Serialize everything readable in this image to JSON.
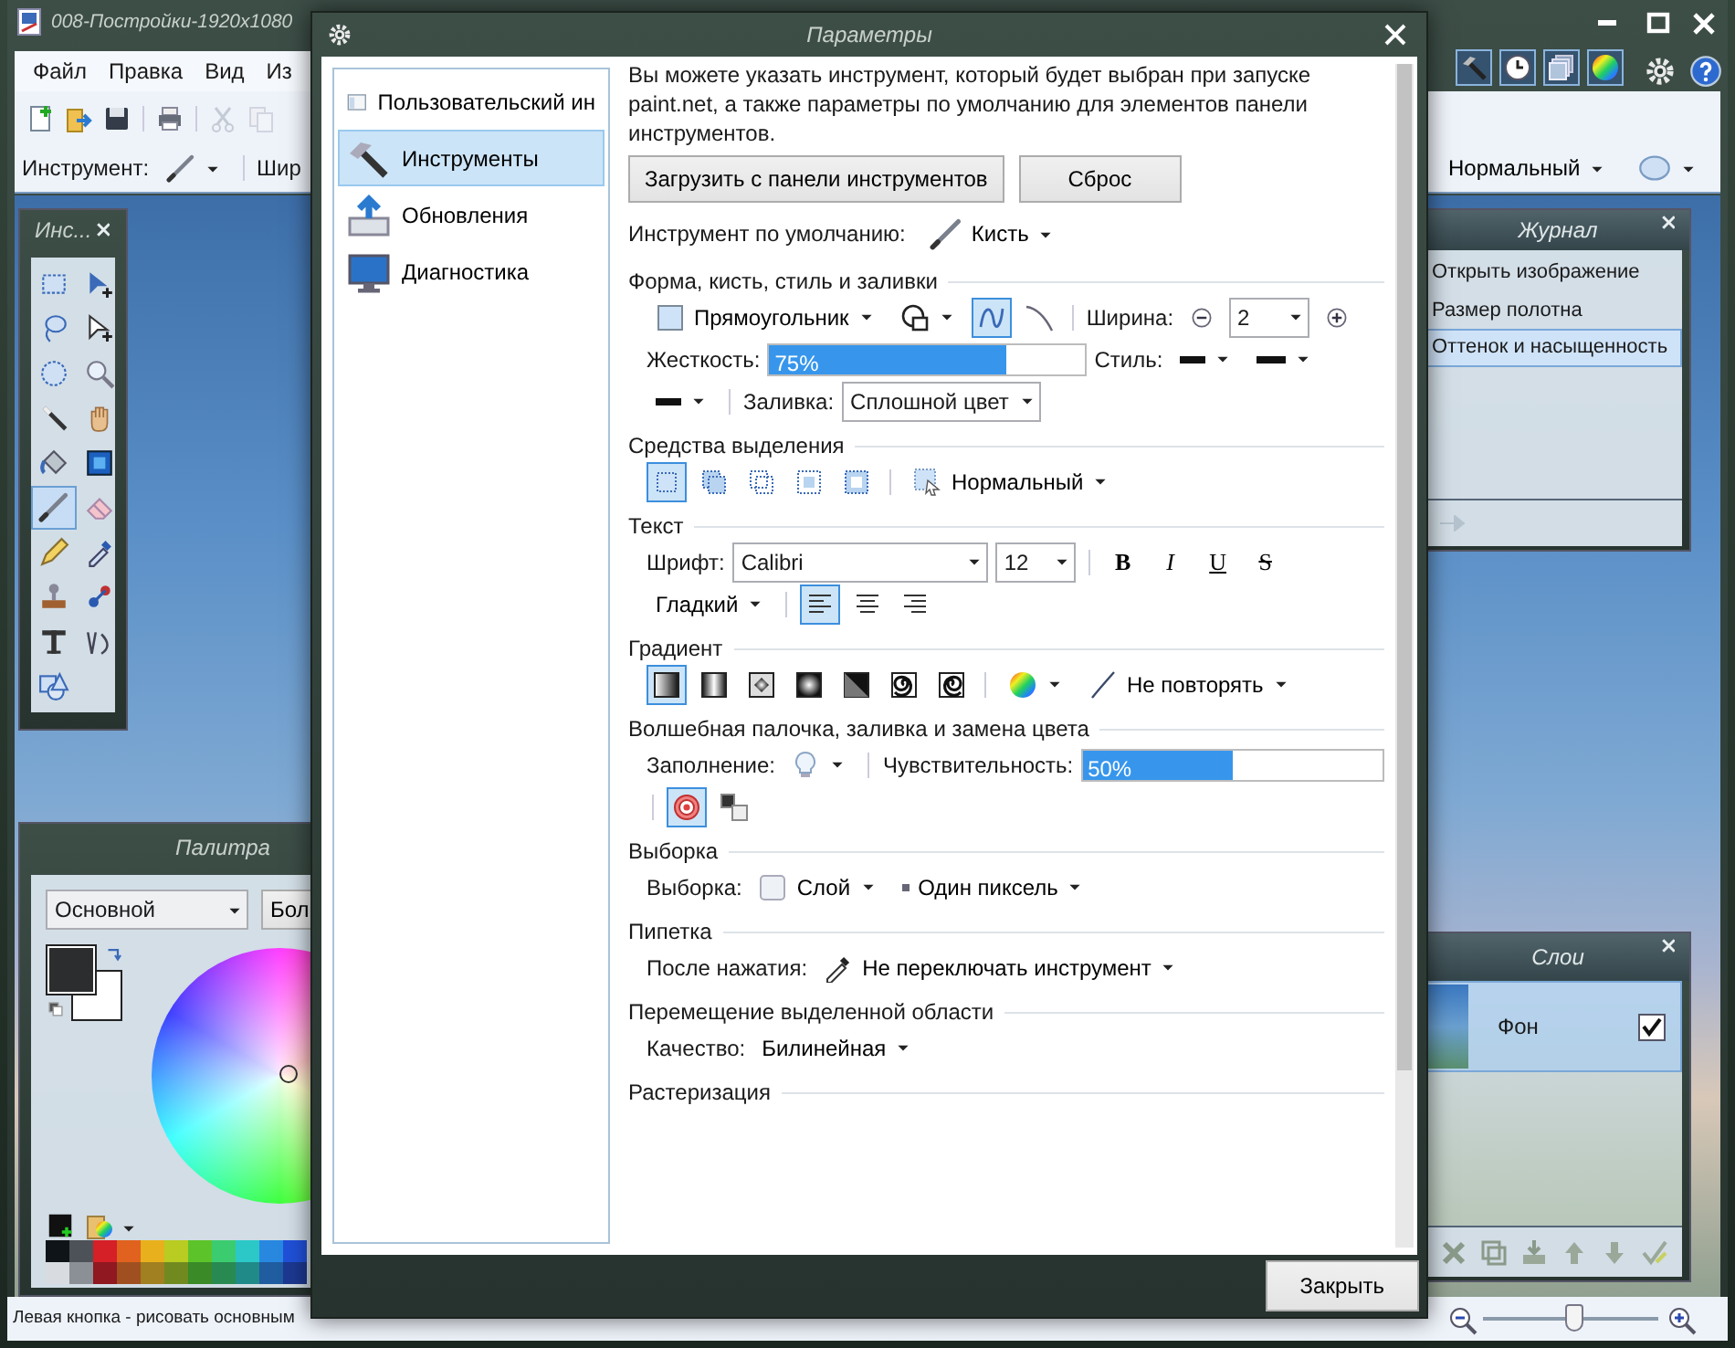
{
  "app": {
    "title": "008-Постройки-1920x1080",
    "menu": [
      "Файл",
      "Правка",
      "Вид",
      "Из"
    ],
    "toolbar": [
      {
        "kind": "new",
        "disabled": false
      },
      {
        "kind": "open",
        "disabled": false
      },
      {
        "kind": "save",
        "disabled": false
      },
      {
        "kind": "print",
        "disabled": false
      },
      {
        "kind": "cut",
        "disabled": true
      },
      {
        "kind": "copy",
        "disabled": true
      }
    ],
    "tool_label": "Инструмент:",
    "width_label": "Шир",
    "blend_mode": "Нормальный",
    "window_toggles": [
      {
        "kind": "tools",
        "on": true
      },
      {
        "kind": "history",
        "on": true
      },
      {
        "kind": "layers",
        "on": true
      },
      {
        "kind": "colors",
        "on": true
      }
    ],
    "status": "Левая кнопка - рисовать основным",
    "zoom": {
      "level": 0.52
    }
  },
  "tools_panel": {
    "title": "Инс...",
    "tools": [
      {
        "kind": "rect-select",
        "selected": false
      },
      {
        "kind": "move-pixels",
        "selected": false
      },
      {
        "kind": "lasso",
        "selected": false
      },
      {
        "kind": "move-selection",
        "selected": false
      },
      {
        "kind": "ellipse-select",
        "selected": false
      },
      {
        "kind": "zoom",
        "selected": false
      },
      {
        "kind": "magic-wand",
        "selected": false
      },
      {
        "kind": "pan",
        "selected": false
      },
      {
        "kind": "bucket",
        "selected": false
      },
      {
        "kind": "gradient",
        "selected": false
      },
      {
        "kind": "brush",
        "selected": true
      },
      {
        "kind": "eraser",
        "selected": false
      },
      {
        "kind": "pencil",
        "selected": false
      },
      {
        "kind": "picker",
        "selected": false
      },
      {
        "kind": "stamp",
        "selected": false
      },
      {
        "kind": "recolor",
        "selected": false
      },
      {
        "kind": "text",
        "selected": false
      },
      {
        "kind": "line",
        "selected": false
      },
      {
        "kind": "shapes",
        "selected": false
      }
    ]
  },
  "palette": {
    "title": "Палитра",
    "mode": "Основной",
    "more": "Бол",
    "colors": [
      {
        "kind": "primary",
        "color": "#2b2d2f"
      },
      {
        "kind": "secondary",
        "color": "#ffffff"
      }
    ],
    "swatch_rows": [
      [
        {
          "color": "#0e1418"
        },
        {
          "color": "#4c5258"
        },
        {
          "color": "#d42026"
        },
        {
          "color": "#e0621e"
        },
        {
          "color": "#e8b01c"
        },
        {
          "color": "#b8cc22"
        },
        {
          "color": "#5cc42a"
        },
        {
          "color": "#3ccc70"
        },
        {
          "color": "#2cc8c8"
        },
        {
          "color": "#2888e0"
        },
        {
          "color": "#2050d8"
        }
      ],
      [
        {
          "color": "#d8dce0"
        },
        {
          "color": "#8a9096"
        },
        {
          "color": "#901820"
        },
        {
          "color": "#a05020"
        },
        {
          "color": "#a08020"
        },
        {
          "color": "#708a20"
        },
        {
          "color": "#3a8a28"
        },
        {
          "color": "#288a50"
        },
        {
          "color": "#208a88"
        },
        {
          "color": "#205ca0"
        },
        {
          "color": "#1c3890"
        }
      ]
    ]
  },
  "history": {
    "title": "Журнал",
    "items": [
      {
        "label": "Открыть изображение",
        "selected": false
      },
      {
        "label": "Размер полотна",
        "selected": false
      },
      {
        "label": "Оттенок и насыщенность",
        "selected": true
      }
    ],
    "redo_disabled": true
  },
  "layers": {
    "title": "Слои",
    "layers": [
      {
        "name": "Фон",
        "visible": true,
        "selected": true
      }
    ]
  },
  "settings": {
    "title": "Параметры",
    "nav": [
      {
        "kind": "ui",
        "label": "Пользовательский ин",
        "selected": false
      },
      {
        "kind": "tools",
        "label": "Инструменты",
        "selected": true
      },
      {
        "kind": "updates",
        "label": "Обновления",
        "selected": false
      },
      {
        "kind": "diagnostics",
        "label": "Диагностика",
        "selected": false
      }
    ],
    "intro": "Вы можете указать инструмент, который будет выбран при запуске paint.net, а также параметры по умолчанию для элементов панели инструментов.",
    "buttons": [
      "Загрузить с панели инструментов",
      "Сброс"
    ],
    "default_tool": {
      "label": "Инструмент по умолчанию:",
      "value": "Кисть"
    },
    "sections": [
      {
        "title": "Форма, кисть, стиль и заливки",
        "lines": [
          {
            "controls": [
              {
                "kind": "shape-dropdown",
                "text": "Прямоугольник"
              },
              {
                "kind": "shape-type-dropdown"
              },
              {
                "kind": "antialias-on-toggle",
                "selected": true
              },
              {
                "kind": "antialias-off-toggle",
                "selected": false
              },
              {
                "kind": "sep"
              },
              {
                "kind": "label",
                "text": "Ширина:"
              },
              {
                "kind": "decrease-button"
              },
              {
                "kind": "select",
                "value": "2"
              },
              {
                "kind": "increase-button"
              }
            ]
          },
          {
            "controls": [
              {
                "kind": "label",
                "text": "Жесткость:"
              },
              {
                "kind": "bar",
                "text": "75%",
                "level": 0.75
              },
              {
                "kind": "label",
                "text": "Стиль:"
              },
              {
                "kind": "dash-dropdown"
              },
              {
                "kind": "line-style-dropdown"
              }
            ]
          },
          {
            "controls": [
              {
                "kind": "cap-dropdown"
              },
              {
                "kind": "sep"
              },
              {
                "kind": "label",
                "text": "Заливка:"
              },
              {
                "kind": "select",
                "value": "Сплошной цвет"
              }
            ]
          }
        ]
      },
      {
        "title": "Средства выделения",
        "lines": [
          {
            "controls": [
              {
                "kind": "replace-mode",
                "selected": true
              },
              {
                "kind": "union-mode",
                "selected": false
              },
              {
                "kind": "exclude-mode",
                "selected": false
              },
              {
                "kind": "intersect-mode",
                "selected": false
              },
              {
                "kind": "xor-mode",
                "selected": false
              },
              {
                "kind": "sep"
              },
              {
                "kind": "selection-blend-dropdown",
                "text": "Нормальный"
              }
            ]
          }
        ]
      },
      {
        "title": "Текст",
        "lines": [
          {
            "controls": [
              {
                "kind": "label",
                "text": "Шрифт:"
              },
              {
                "kind": "select",
                "value": "Calibri"
              },
              {
                "kind": "select",
                "value": "12"
              },
              {
                "kind": "sep"
              },
              {
                "kind": "bold-toggle",
                "text": "B",
                "selected": false
              },
              {
                "kind": "italic-toggle",
                "text": "I",
                "selected": false
              },
              {
                "kind": "underline-toggle",
                "text": "U",
                "selected": false
              },
              {
                "kind": "strike-toggle",
                "text": "S",
                "selected": false
              }
            ]
          },
          {
            "controls": [
              {
                "kind": "plain-dropdown",
                "text": "Гладкий"
              },
              {
                "kind": "sep"
              },
              {
                "kind": "align-left-toggle",
                "selected": true
              },
              {
                "kind": "align-center-toggle",
                "selected": false
              },
              {
                "kind": "align-right-toggle",
                "selected": false
              }
            ]
          }
        ]
      },
      {
        "title": "Градиент",
        "lines": [
          {
            "controls": [
              {
                "kind": "linear-gradient",
                "selected": true
              },
              {
                "kind": "reflected-gradient",
                "selected": false
              },
              {
                "kind": "diamond-gradient",
                "selected": false
              },
              {
                "kind": "radial-gradient",
                "selected": false
              },
              {
                "kind": "conical-gradient",
                "selected": false
              },
              {
                "kind": "spiral-cw-gradient",
                "selected": false
              },
              {
                "kind": "spiral-ccw-gradient",
                "selected": false
              },
              {
                "kind": "sep"
              },
              {
                "kind": "color-mode-dropdown"
              },
              {
                "kind": "repeat-dropdown",
                "text": "Не повторять"
              }
            ]
          }
        ]
      },
      {
        "title": "Волшебная палочка, заливка и замена цвета",
        "lines": [
          {
            "controls": [
              {
                "kind": "label",
                "text": "Заполнение:"
              },
              {
                "kind": "flood-mode-dropdown"
              },
              {
                "kind": "sep"
              },
              {
                "kind": "label",
                "text": "Чувствительность:"
              },
              {
                "kind": "bar",
                "text": "50%",
                "level": 0.5
              }
            ]
          },
          {
            "controls": [
              {
                "kind": "sep"
              },
              {
                "kind": "target-toggle",
                "selected": true
              },
              {
                "kind": "color-pair-toggle",
                "selected": false
              }
            ]
          }
        ]
      },
      {
        "title": "Выборка",
        "lines": [
          {
            "controls": [
              {
                "kind": "label",
                "text": "Выборка:"
              },
              {
                "kind": "layer-sampling-dropdown",
                "text": "Слой"
              },
              {
                "kind": "pixel-sampling-dropdown",
                "text": "Один пиксель"
              }
            ]
          }
        ]
      },
      {
        "title": "Пипетка",
        "lines": [
          {
            "controls": [
              {
                "kind": "label",
                "text": "После нажатия:"
              },
              {
                "kind": "picker-dropdown",
                "text": "Не переключать инструмент"
              }
            ]
          }
        ]
      },
      {
        "title": "Перемещение выделенной области",
        "lines": [
          {
            "controls": [
              {
                "kind": "label",
                "text": "Качество:"
              },
              {
                "kind": "plain-dropdown",
                "text": "Билинейная"
              }
            ]
          }
        ]
      },
      {
        "title": "Растеризация"
      }
    ],
    "close": "Закрыть"
  }
}
